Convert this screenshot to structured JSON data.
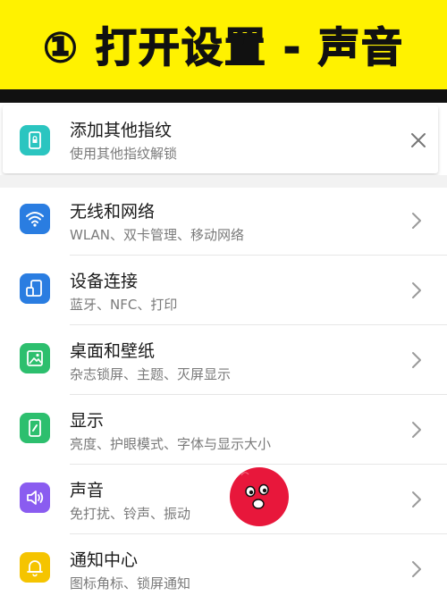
{
  "banner": {
    "title": "① 打开设置 - 声音"
  },
  "suggestion": {
    "title": "添加其他指纹",
    "subtitle": "使用其他指纹解锁",
    "icon": "fingerprint-lock-icon",
    "icon_color": "#2bc5c0"
  },
  "settings": {
    "items": [
      {
        "title": "无线和网络",
        "subtitle": "WLAN、双卡管理、移动网络",
        "icon": "wifi-icon",
        "color": "#2a7de1"
      },
      {
        "title": "设备连接",
        "subtitle": "蓝牙、NFC、打印",
        "icon": "device-connect-icon",
        "color": "#2a7de1"
      },
      {
        "title": "桌面和壁纸",
        "subtitle": "杂志锁屏、主题、灭屏显示",
        "icon": "wallpaper-icon",
        "color": "#2dbf6e"
      },
      {
        "title": "显示",
        "subtitle": "亮度、护眼模式、字体与显示大小",
        "icon": "display-icon",
        "color": "#2dbf6e"
      },
      {
        "title": "声音",
        "subtitle": "免打扰、铃声、振动",
        "icon": "speaker-icon",
        "color": "#8a5cf0"
      },
      {
        "title": "通知中心",
        "subtitle": "图标角标、锁屏通知",
        "icon": "bell-icon",
        "color": "#f5c400"
      }
    ]
  }
}
